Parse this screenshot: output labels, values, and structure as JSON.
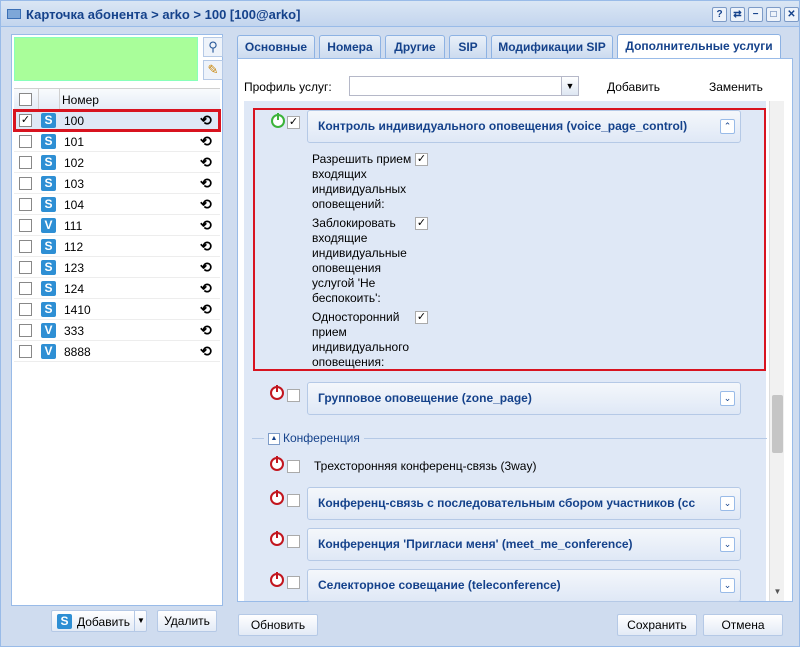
{
  "window": {
    "title": "Карточка абонента > arko > 100 [100@arko]",
    "buttons": [
      "?",
      "⇄",
      "−",
      "□",
      "✕"
    ]
  },
  "left": {
    "grid_header": "Номер",
    "rows": [
      {
        "num": "100",
        "type": "S",
        "checked": true
      },
      {
        "num": "101",
        "type": "S"
      },
      {
        "num": "102",
        "type": "S"
      },
      {
        "num": "103",
        "type": "S"
      },
      {
        "num": "104",
        "type": "S"
      },
      {
        "num": "111",
        "type": "V"
      },
      {
        "num": "112",
        "type": "S"
      },
      {
        "num": "123",
        "type": "S"
      },
      {
        "num": "124",
        "type": "S"
      },
      {
        "num": "1410",
        "type": "S"
      },
      {
        "num": "333",
        "type": "V"
      },
      {
        "num": "8888",
        "type": "V"
      }
    ],
    "add_label": "Добавить",
    "delete_label": "Удалить"
  },
  "tabs": [
    "Основные",
    "Номера",
    "Другие",
    "SIP",
    "Модификации SIP",
    "Дополнительные услуги"
  ],
  "active_tab": 5,
  "profile": {
    "label": "Профиль услуг:",
    "value": "",
    "add": "Добавить",
    "replace": "Заменить"
  },
  "services": {
    "voice_page": {
      "title": "Контроль индивидуального оповещения (voice_page_control)",
      "options": [
        {
          "label": "Разрешить прием входящих индивидуальных оповещений:",
          "checked": true
        },
        {
          "label": "Заблокировать входящие индивидуальные оповещения услугой 'Не беспокоить':",
          "checked": true
        },
        {
          "label": "Односторонний прием индивидуального оповещения:",
          "checked": true
        }
      ]
    },
    "zone_page": {
      "title": "Групповое оповещение (zone_page)"
    },
    "conference_group": "Конференция",
    "three_way": "Трехсторонняя конференц-связь (3way)",
    "seq_conf": "Конференц-связь с последовательным сбором участников (cc",
    "meet_me": "Конференция 'Пригласи меня' (meet_me_conference)",
    "teleconf": "Селекторное совещание (teleconference)"
  },
  "footer": {
    "refresh": "Обновить",
    "save": "Сохранить",
    "cancel": "Отмена"
  },
  "icons": {
    "search": "search-icon",
    "edit": "pencil-icon",
    "history": "history-icon",
    "power": "power-icon"
  }
}
